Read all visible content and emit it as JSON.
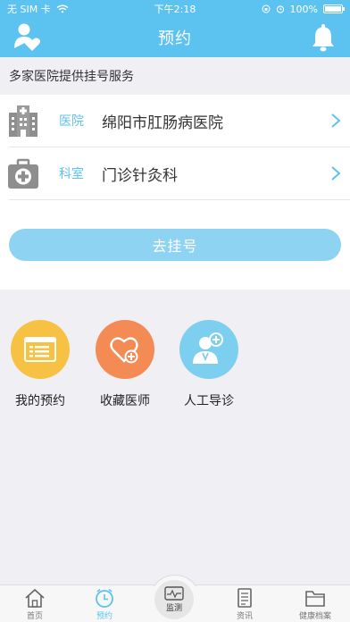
{
  "status": {
    "carrier": "无 SIM 卡",
    "time": "下午2:18",
    "battery": "100%"
  },
  "nav": {
    "title": "预约",
    "left_icon": "user-heart-icon",
    "right_icon": "bell-icon"
  },
  "hint": "多家医院提供挂号服务",
  "rows": [
    {
      "key": "医院",
      "value": "绵阳市肛肠病医院",
      "icon": "hospital-building-icon"
    },
    {
      "key": "科室",
      "value": "门诊针灸科",
      "icon": "medical-kit-icon"
    }
  ],
  "go_button": "去挂号",
  "actions": [
    {
      "label": "我的预约",
      "color": "#f7c244",
      "icon": "appointment-list-icon"
    },
    {
      "label": "收藏医师",
      "color": "#f48a54",
      "icon": "favorite-doctor-icon"
    },
    {
      "label": "人工导诊",
      "color": "#7ccfee",
      "icon": "manual-guide-icon"
    }
  ],
  "tabs": [
    {
      "label": "首页",
      "icon": "home-icon",
      "active": false
    },
    {
      "label": "预约",
      "icon": "clock-icon",
      "active": true
    },
    {
      "label": "监测",
      "icon": "monitor-icon",
      "active": false
    },
    {
      "label": "资讯",
      "icon": "news-icon",
      "active": false
    },
    {
      "label": "健康档案",
      "icon": "folder-icon",
      "active": false
    }
  ],
  "colors": {
    "brand": "#5cc2ef",
    "button": "#8fd3f3",
    "background": "#efeff4"
  }
}
